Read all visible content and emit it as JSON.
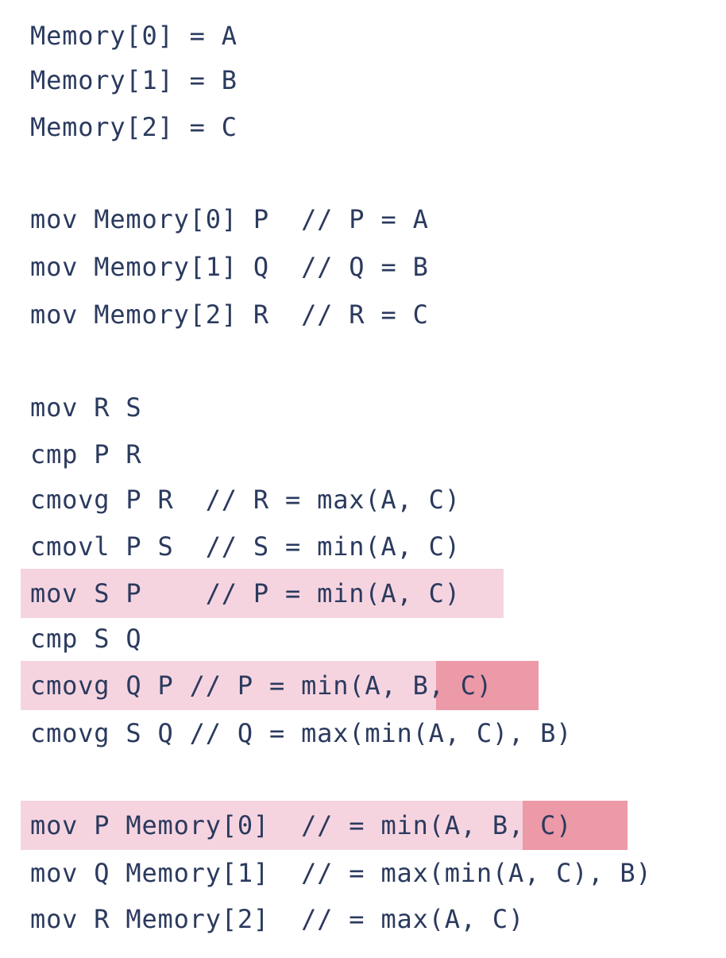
{
  "code_block": {
    "lines": [
      "Memory[0] = A",
      "Memory[1] = B",
      "Memory[2] = C",
      "mov Memory[0] P  // P = A",
      "mov Memory[1] Q  // Q = B",
      "mov Memory[2] R  // R = C",
      "mov R S",
      "cmp P R",
      "cmovg P R  // R = max(A, C)",
      "cmovl P S  // S = min(A, C)",
      "mov S P    // P = min(A, C)",
      "cmp S Q",
      "cmovg Q P // P = min(A, B, C)",
      "cmovg S Q // Q = max(min(A, C), B)",
      "mov P Memory[0]  // = min(A, B, C)",
      "mov Q Memory[1]  // = max(min(A, C), B)",
      "mov R Memory[2]  // = max(A, C)"
    ],
    "highlighted_lines": [
      10,
      12,
      14
    ],
    "strong_highlight_text": "B, C)",
    "colors": {
      "text": "#2b3a5e",
      "highlight": "#f5d4e0",
      "strong_highlight": "#ec99a8",
      "background": "#ffffff"
    }
  }
}
